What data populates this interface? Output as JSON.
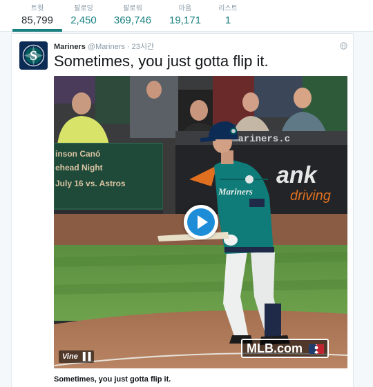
{
  "stats": [
    {
      "label": "트윗",
      "value": "85,799"
    },
    {
      "label": "팔로잉",
      "value": "2,450"
    },
    {
      "label": "팔로워",
      "value": "369,746"
    },
    {
      "label": "마음",
      "value": "19,171"
    },
    {
      "label": "리스트",
      "value": "1"
    }
  ],
  "tweet": {
    "name": "Mariners",
    "handle": "@Mariners",
    "separator": "·",
    "time": "23시간",
    "text": "Sometimes, you just gotta flip it.",
    "caption": "Sometimes, you just gotta flip it."
  },
  "video": {
    "banner_text_1": "inson Canó",
    "banner_text_2": "ehead Night",
    "banner_text_3": "July 16 vs. Astros",
    "wall_url": "mariners.c",
    "ad_text_1": "ank",
    "ad_text_2": "driving",
    "jersey_text": "Mariners",
    "vine_label": "Vine",
    "mlb_label": "MLB.com"
  },
  "colors": {
    "accent": "#1b8080",
    "play": "#1d8dd8",
    "mariners_navy": "#0c2c56",
    "mariners_teal": "#005c5c"
  }
}
